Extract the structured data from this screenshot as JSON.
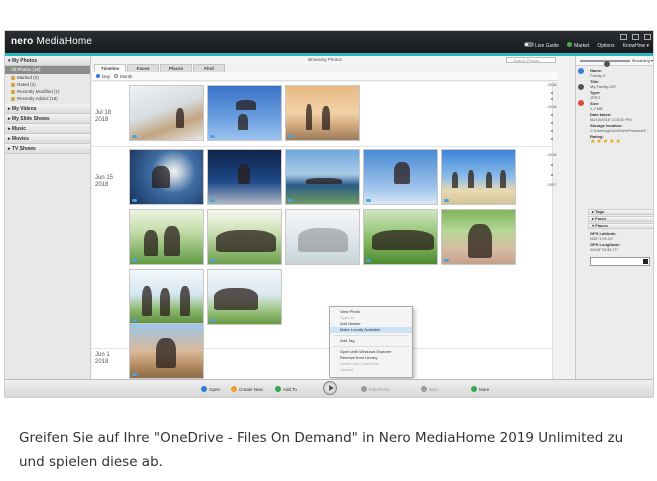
{
  "app": {
    "logo_brand": "nero",
    "logo_product": "MediaHome",
    "topnav": {
      "live_guide": "Live Guide",
      "market": "Market",
      "options": "Options",
      "knowhow": "KnowHow ▾"
    }
  },
  "sidebar": {
    "photos_header": "▾ My Photos",
    "photos_items": [
      {
        "label": "All Photos (18)",
        "selected": true
      },
      {
        "label": "Marked (0)"
      },
      {
        "label": "Rated (2)"
      },
      {
        "label": "Recently Modified (1)"
      },
      {
        "label": "Recently Added (18)"
      }
    ],
    "sections": [
      "▸ My Videos",
      "▸ My Slide Shows",
      "▸ Music",
      "▸ Movies",
      "▸ TV Shows"
    ]
  },
  "center": {
    "title": "Browsing Photos",
    "search_placeholder": "Search Photos",
    "tabs": [
      "Timeline",
      "Faces",
      "Places",
      "Find"
    ],
    "view_modes": [
      "Day",
      "Month"
    ],
    "date_groups": [
      {
        "month_day": "Jul 18",
        "year": "2018"
      },
      {
        "month_day": "Jun 15",
        "year": "2018"
      },
      {
        "month_day": "Jun 1",
        "year": "2018"
      }
    ],
    "years": [
      "2018",
      "2016",
      "2015",
      "2007"
    ]
  },
  "context_menu": {
    "items": [
      {
        "label": "View Photo"
      },
      {
        "label": "Open In",
        "disabled": true
      },
      {
        "label": "Add Marker"
      },
      {
        "label": "Make Locally Available",
        "highlighted": true
      },
      {
        "sep": true
      },
      {
        "label": "Add Tag"
      },
      {
        "sep": true
      },
      {
        "label": "Open with Windows Explorer"
      },
      {
        "label": "Remove from Library"
      },
      {
        "label": "Delete from Hard Disk",
        "disabled": true
      },
      {
        "label": "Upload",
        "disabled": true
      }
    ]
  },
  "right_panel": {
    "streaming": "Streaming ▾",
    "name_label": "Name:",
    "name_value": "Family-3",
    "title_label": "Title:",
    "title_value": "My Family-007",
    "type_label": "Type:",
    "type_value": "JPEG",
    "size_label": "Size:",
    "size_value": "2.2 MB",
    "date_label": "Date taken:",
    "date_value": "06/15/2018 1:03:30 PM",
    "storage_label": "Storage location:",
    "storage_value": "C:\\Users\\g\\OneDrive\\Pictures\\F...",
    "rating_label": "Rating:",
    "rating_stars": "★★★★★",
    "section_tags": "▸ Tags",
    "section_faces": "▸ Faces",
    "section_places": "▾ Places",
    "gps_lat_label": "GPS Latitude:",
    "gps_lat_value": "N34°1'19.24\"",
    "gps_lon_label": "GPS Longitude:",
    "gps_lon_value": "W118°15'45.71\""
  },
  "bottombar": {
    "buttons": [
      {
        "label": "Open",
        "color": "#2b7fd6"
      },
      {
        "label": "Create New",
        "color": "#e8a12a"
      },
      {
        "label": "Add To",
        "color": "#3aa655"
      },
      {
        "label": "Edit Photo",
        "color": "#9a9a9a",
        "disabled": true
      },
      {
        "label": "Burn",
        "color": "#9a9a9a",
        "disabled": true
      },
      {
        "label": "More",
        "color": "#3aa655"
      }
    ]
  },
  "caption": "Greifen Sie auf Ihre \"OneDrive - Files On Demand\" in Nero MediaHome 2019 Unlimited zu und spielen diese ab."
}
